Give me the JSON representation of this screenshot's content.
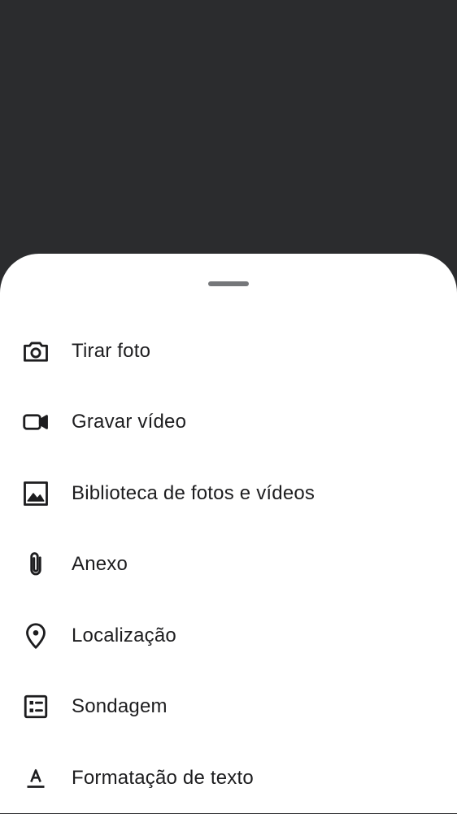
{
  "sheet": {
    "items": [
      {
        "label": "Tirar foto",
        "icon": "camera-icon"
      },
      {
        "label": "Gravar vídeo",
        "icon": "videocam-icon"
      },
      {
        "label": "Biblioteca de fotos e vídeos",
        "icon": "image-icon"
      },
      {
        "label": "Anexo",
        "icon": "paperclip-icon"
      },
      {
        "label": "Localização",
        "icon": "location-pin-icon"
      },
      {
        "label": "Sondagem",
        "icon": "poll-icon"
      },
      {
        "label": "Formatação de texto",
        "icon": "text-format-icon"
      }
    ]
  },
  "colors": {
    "scrim": "#2b2c2e",
    "sheet": "#ffffff",
    "text": "#1d1d1f",
    "icon": "#1d1d1f",
    "handle": "#75777a"
  }
}
